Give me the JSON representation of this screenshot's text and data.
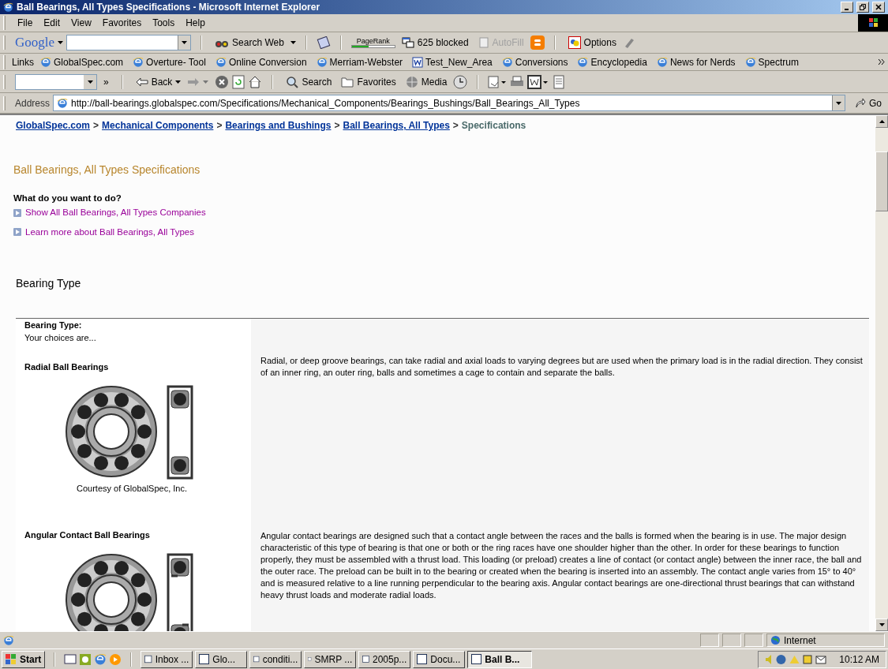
{
  "window": {
    "title": "Ball Bearings, All Types Specifications - Microsoft Internet Explorer"
  },
  "menu": [
    "File",
    "Edit",
    "View",
    "Favorites",
    "Tools",
    "Help"
  ],
  "google_toolbar": {
    "logo": "Google",
    "search_button": "Search Web",
    "pagerank": {
      "label": "PageRank",
      "level": 0.4
    },
    "blocked": "625 blocked",
    "autofill": {
      "label": "AutoFill",
      "disabled": true
    },
    "options": "Options"
  },
  "links_bar": {
    "label": "Links",
    "items": [
      {
        "label": "GlobalSpec.com",
        "kind": "ie"
      },
      {
        "label": "Overture- Tool",
        "kind": "ie"
      },
      {
        "label": "Online Conversion",
        "kind": "ie"
      },
      {
        "label": "Merriam-Webster",
        "kind": "ie"
      },
      {
        "label": "Test_New_Area",
        "kind": "word"
      },
      {
        "label": "Conversions",
        "kind": "ie"
      },
      {
        "label": "Encyclopedia",
        "kind": "ie"
      },
      {
        "label": "News for Nerds",
        "kind": "ie"
      },
      {
        "label": "Spectrum",
        "kind": "ie"
      }
    ]
  },
  "toolbar": {
    "more": "»",
    "back": "Back",
    "search": "Search",
    "favorites": "Favorites",
    "media": "Media"
  },
  "address": {
    "label": "Address",
    "value": "http://ball-bearings.globalspec.com/Specifications/Mechanical_Components/Bearings_Bushings/Ball_Bearings_All_Types",
    "go": "Go"
  },
  "page": {
    "breadcrumbs": [
      {
        "label": "GlobalSpec.com",
        "kind": "link"
      },
      {
        "label": ">",
        "kind": "separator"
      },
      {
        "label": "Mechanical Components",
        "kind": "link"
      },
      {
        "label": ">",
        "kind": "separator"
      },
      {
        "label": "Bearings and Bushings",
        "kind": "link"
      },
      {
        "label": ">",
        "kind": "separator"
      },
      {
        "label": "Ball Bearings, All Types",
        "kind": "link"
      },
      {
        "label": ">",
        "kind": "separator"
      },
      {
        "label": "Specifications",
        "kind": "current"
      }
    ],
    "title": "Ball Bearings, All Types Specifications",
    "prompt": "What do you want to do?",
    "actions": [
      "Show All Ball Bearings, All Types Companies",
      "Learn more about Ball Bearings, All Types"
    ],
    "section_title": "Bearing Type",
    "table": {
      "header": "Bearing Type:",
      "subheader": "Your choices are...",
      "rows": [
        {
          "kind": "radial",
          "name": "Radial Ball Bearings",
          "caption": "Courtesy of GlobalSpec, Inc.",
          "description": "Radial, or deep groove bearings, can take radial and axial loads to varying degrees but are used when the primary load is in the radial direction. They consist of an inner ring, an outer ring, balls and sometimes a cage to contain and separate the balls."
        },
        {
          "kind": "angular",
          "name": "Angular Contact Ball Bearings",
          "description": "Angular contact bearings are designed such that a contact angle between the races and the balls is formed when the bearing is in use.  The major design characteristic of this type of bearing is that one or both or the ring races have one shoulder higher than the other.  In order for these bearings to function properly, they must be assembled with a thrust load.  This loading (or preload) creates a line of contact (or contact angle) between the inner race, the ball and the outer race. The preload can be built in to the bearing or created when the bearing is inserted into an assembly.  The contact angle varies from 15° to 40° and is measured relative to a line running perpendicular to the bearing axis.  Angular contact bearings are one-directional thrust bearings that can withstand heavy thrust loads and moderate radial loads."
        }
      ]
    }
  },
  "status_bar": {
    "zone": "Internet"
  },
  "taskbar": {
    "start": "Start",
    "tasks": [
      {
        "label": "Inbox ...",
        "selected": false
      },
      {
        "label": "Glo...",
        "selected": false
      },
      {
        "label": "conditi...",
        "selected": false
      },
      {
        "label": "SMRP ...",
        "selected": false
      },
      {
        "label": "2005p...",
        "selected": false
      },
      {
        "label": "Docu...",
        "selected": false
      },
      {
        "label": "Ball B...",
        "selected": true
      }
    ],
    "clock": "10:12 AM"
  }
}
